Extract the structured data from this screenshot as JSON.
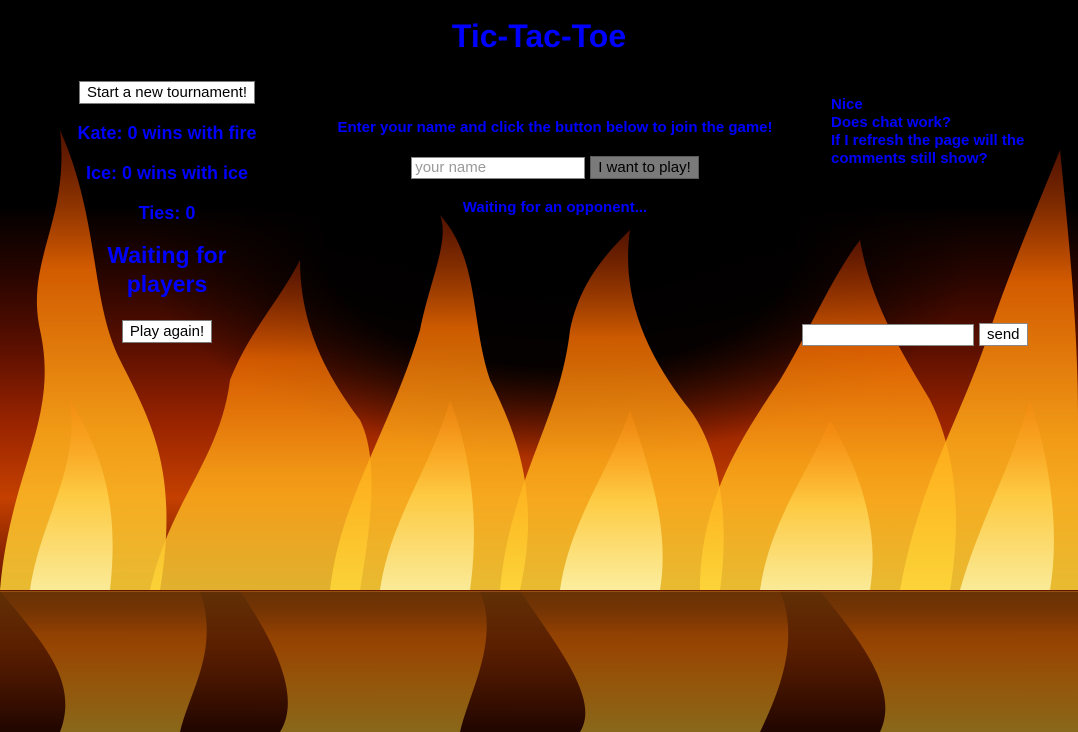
{
  "page": {
    "title": "Tic-Tac-Toe",
    "text_color": "#0000ff",
    "background": "fire-flames-image"
  },
  "left_panel": {
    "new_tournament_label": "Start a new tournament!",
    "score_player1": "Kate: 0 wins with fire",
    "score_player2": "Ice: 0 wins with ice",
    "score_ties": "Ties: 0",
    "status": "Waiting for players",
    "play_again_label": "Play again!"
  },
  "join": {
    "instructions": "Enter your name and click the button below to join the game!",
    "name_placeholder": "your name",
    "name_value": "",
    "join_button_label": "I want to play!",
    "waiting_text": "Waiting for an opponent..."
  },
  "chat": {
    "messages": [
      "Nice",
      "Does chat work?",
      "If I refresh the page will the comments still show?"
    ],
    "input_value": "",
    "send_label": "send"
  }
}
